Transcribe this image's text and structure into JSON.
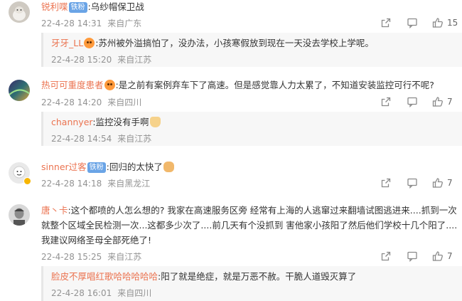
{
  "comments": [
    {
      "user": "锐利喋",
      "badge": "铁粉",
      "text": ":乌纱帽保卫战",
      "date": "22-4-28 14:31",
      "location": "来自广东",
      "likes": "15",
      "replies": [
        {
          "user": "牙牙_LL",
          "text": ":苏州被外溢搞怕了，没办法，小孩寒假放到现在一天没去学校上学呢。",
          "date": "22-4-28 15:20",
          "location": "来自江苏"
        }
      ]
    },
    {
      "user": "热可可重度患者",
      "text": ":是之前有案例弃车下了高速。但是感觉靠人力太累了，不知道安装监控可行不呢?",
      "date": "22-4-28 14:20",
      "location": "来自四川",
      "likes": "7",
      "replies": [
        {
          "user": "channyer",
          "text": ":监控没有手啊",
          "date": "22-4-28 14:54",
          "location": "来自江苏"
        }
      ]
    },
    {
      "user": "sinner过客",
      "badge": "铁粉",
      "text": ":回归的太快了",
      "date": "22-4-28 14:18",
      "location": "来自黑龙江",
      "likes": "7"
    },
    {
      "user": "唐丶卡",
      "text_lines": [
        ":这个都喷的人怎么想的? 我家在高速服务区旁 经常有上海的人逃窜过来翻墙试图逃进来....抓到一次",
        "就整个区域全民检测一次...这都多少次了....前几天有个没抓到 害他家小孩阳了然后他们学校十几个阳了....",
        "我建议网络圣母全部死绝了!"
      ],
      "date": "22-4-28 15:25",
      "location": "来自江苏",
      "likes": "7",
      "replies": [
        {
          "user": "脸皮不厚唱红歌哈哈哈哈哈",
          "text": ":阳了就是绝症，就是万恶不赦。干脆人道毁灭算了",
          "date": "22-4-28 16:01",
          "location": "来自四川"
        }
      ]
    }
  ],
  "icons": {
    "share": "share-icon",
    "comment": "comment-icon",
    "like": "thumbs-up-icon"
  },
  "colors": {
    "username": "#eb7350",
    "meta": "#939393",
    "fan_badge": "#6aa4e6",
    "reply_bg": "#f7f7f7"
  }
}
